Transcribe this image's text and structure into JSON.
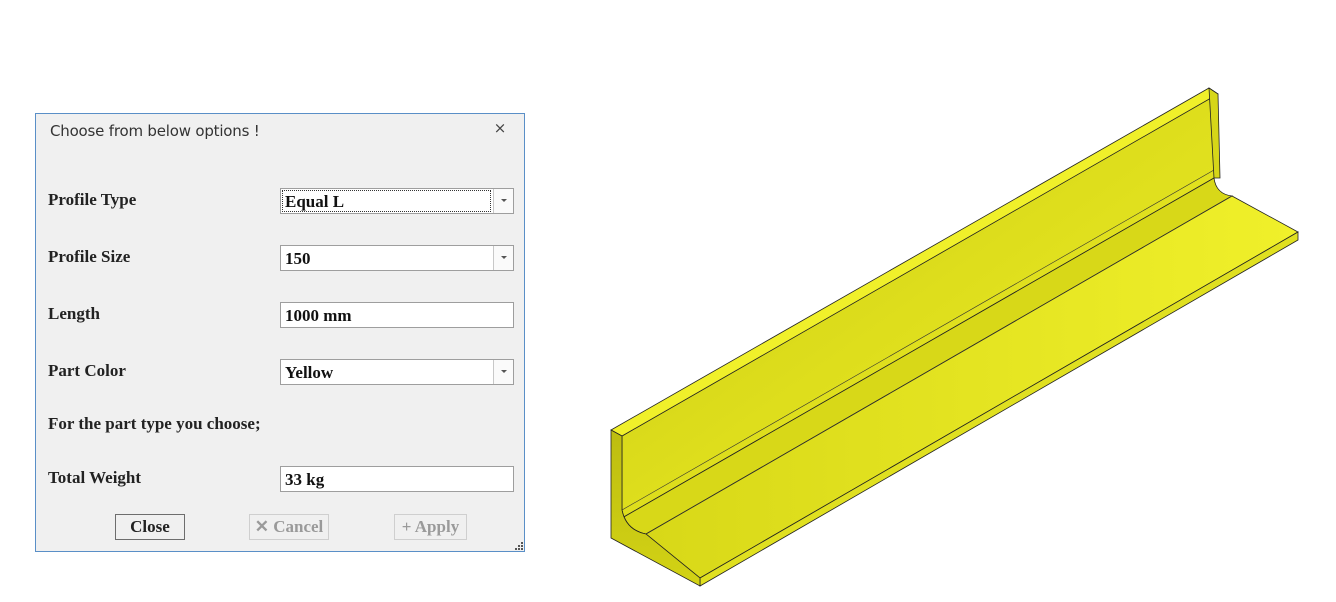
{
  "dialog": {
    "title": "Choose from below options !",
    "close_glyph": "×",
    "rows": [
      {
        "label": "Profile Type",
        "value": "Equal L",
        "control": "dropdown"
      },
      {
        "label": "Profile Size",
        "value": "150",
        "control": "dropdown"
      },
      {
        "label": "Length",
        "value": "1000 mm",
        "control": "text"
      },
      {
        "label": "Part Color",
        "value": "Yellow",
        "control": "dropdown"
      }
    ],
    "info_text": "For the part type you choose;",
    "weight": {
      "label": "Total Weight",
      "value": "33 kg"
    },
    "buttons": {
      "close": "Close",
      "cancel": "✕ Cancel",
      "apply": "+ Apply"
    }
  },
  "model": {
    "shape": "equal-angle-L-profile",
    "color": "#e8e820"
  },
  "colors": {
    "dialog_bg": "#f0f0f0",
    "dialog_border": "#5a8fc7",
    "part_yellow": "#e8e820"
  }
}
